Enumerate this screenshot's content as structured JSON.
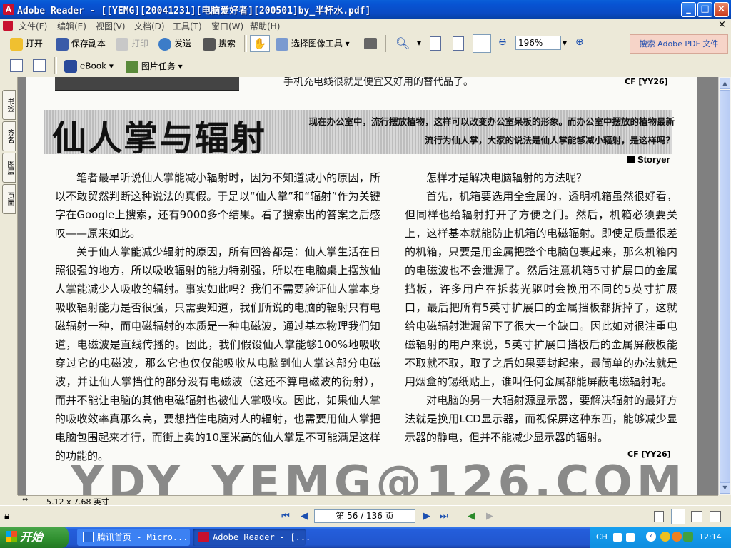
{
  "window": {
    "title": "Adobe Reader - [[YEMG][20041231][电脑爱好者][200501]by_半杯水.pdf]"
  },
  "menu": [
    "文件(F)",
    "编辑(E)",
    "视图(V)",
    "文档(D)",
    "工具(T)",
    "窗口(W)",
    "帮助(H)"
  ],
  "toolbar": {
    "open": "打开",
    "save_copy": "保存副本",
    "print": "打印",
    "send": "发送",
    "search": "搜索",
    "select_image": "选择图像工具",
    "zoom": "196%",
    "search_adobe": "搜索 Adobe PDF 文件",
    "ebook": "eBook",
    "picture_tasks": "图片任务"
  },
  "side_tabs": [
    "书签",
    "签名",
    "图层",
    "页面"
  ],
  "article": {
    "top_text": "手机充电线很就是便宜又好用的替代品了。",
    "top_cf": "CF [YY26]",
    "headline": "仙人掌与辐射",
    "intro": "现在办公室中，流行摆放植物，这样可以改变办公室呆板的形象。而办公室中摆放的植物最新流行为仙人掌，大家的说法是仙人掌能够减小辐射，是这样吗？",
    "byline": "Storyer",
    "left_p1": "笔者最早听说仙人掌能减小辐射时，因为不知道减小的原因，所以不敢贸然判断这种说法的真假。于是以“仙人掌”和“辐射”作为关键字在Google上搜索，还有9000多个结果。看了搜索出的答案之后感叹——原来如此。",
    "left_p2": "关于仙人掌能减少辐射的原因，所有回答都是：仙人掌生活在日照很强的地方，所以吸收辐射的能力特别强，所以在电脑桌上摆放仙人掌能减少人吸收的辐射。事实如此吗？我们不需要验证仙人掌本身吸收辐射能力是否很强，只需要知道，我们所说的电脑的辐射只有电磁辐射一种，而电磁辐射的本质是一种电磁波，通过基本物理我们知道，电磁波是直线传播的。因此，我们假设仙人掌能够100%地吸收穿过它的电磁波，那么它也仅仅能吸收从电脑到仙人掌这部分电磁波，并让仙人掌挡住的部分没有电磁波（这还不算电磁波的衍射），而并不能让电脑的其他电磁辐射也被仙人掌吸收。因此，如果仙人掌的吸收效率真那么高，要想挡住电脑对人的辐射，也需要用仙人掌把电脑包围起来才行，而街上卖的10厘米高的仙人掌是不可能满足这样的功能的。",
    "right_p1": "怎样才是解决电脑辐射的方法呢？",
    "right_p2": "首先，机箱要选用全金属的，透明机箱虽然很好看，但同样也给辐射打开了方便之门。然后，机箱必须要关上，这样基本就能防止机箱的电磁辐射。即使是质量很差的机箱，只要是用金属把整个电脑包裹起来，那么机箱内的电磁波也不会泄漏了。然后注意机箱5寸扩展口的金属挡板，许多用户在拆装光驱时会换用不同的5英寸扩展口，最后把所有5英寸扩展口的金属挡板都拆掉了，这就给电磁辐射泄漏留下了很大一个缺口。因此如对很注重电磁辐射的用户来说，5英寸扩展口挡板后的金属屏蔽板能不取就不取，取了之后如果要封起来，最简单的办法就是用烟盒的锡纸贴上，谁叫任何金属都能屏蔽电磁辐射呢。",
    "right_p3": "对电脑的另一大辐射源显示器，要解决辐射的最好方法就是换用LCD显示器，而视保屏这种东西，能够减少显示器的静电，但并不能减少显示器的辐射。",
    "end_cf": "CF [YY26]",
    "watermark": "YDY_YEMG@126.COM"
  },
  "status": {
    "page_size": "5.12 x 7.68 英寸"
  },
  "nav": {
    "page_indicator": "第 56 / 136 页"
  },
  "taskbar": {
    "start": "开始",
    "tasks": [
      "腾讯首页 - Micro...",
      "Adobe Reader - [..."
    ],
    "ime": "CH",
    "clock": "12:14"
  }
}
